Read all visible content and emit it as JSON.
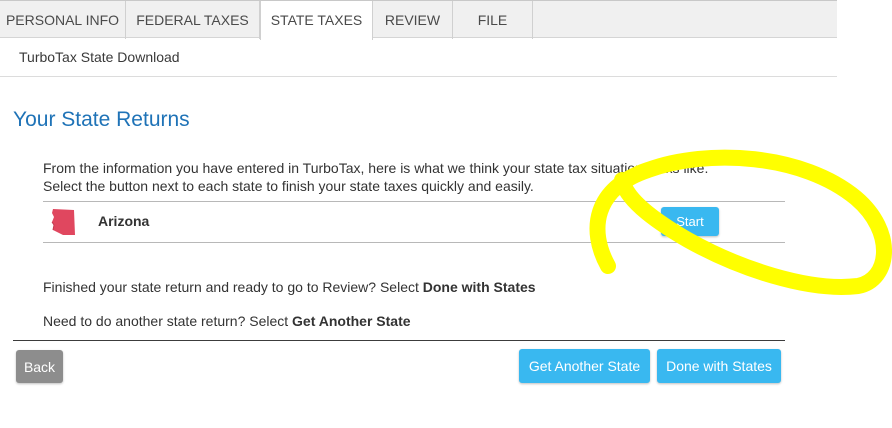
{
  "tabs": [
    {
      "label": "PERSONAL INFO",
      "active": false
    },
    {
      "label": "FEDERAL TAXES",
      "active": false
    },
    {
      "label": "STATE TAXES",
      "active": true
    },
    {
      "label": "REVIEW",
      "active": false
    },
    {
      "label": "FILE",
      "active": false
    }
  ],
  "subnav": {
    "label": "TurboTax State Download"
  },
  "page": {
    "title": "Your State Returns"
  },
  "intro": {
    "line1": "From the information you have entered in TurboTax, here is what we think your state tax situation looks like.",
    "line2": "Select the button next to each state to finish your state taxes quickly and easily."
  },
  "states": [
    {
      "name": "Arizona",
      "icon": "arizona-state-shape-icon",
      "action_label": "Start"
    }
  ],
  "instructions": {
    "done_prefix": "Finished your state return and ready to go to Review? Select ",
    "done_emphasis": "Done with States",
    "another_prefix": "Need to do another state return? Select ",
    "another_emphasis": "Get Another State"
  },
  "footer": {
    "back_label": "Back",
    "get_another_label": "Get Another State",
    "done_label": "Done with States"
  },
  "colors": {
    "title_blue": "#1f73b7",
    "button_blue": "#39b8f0",
    "button_gray": "#8d8d8d",
    "state_red": "#e0475f",
    "highlight_yellow": "#ffff00"
  }
}
